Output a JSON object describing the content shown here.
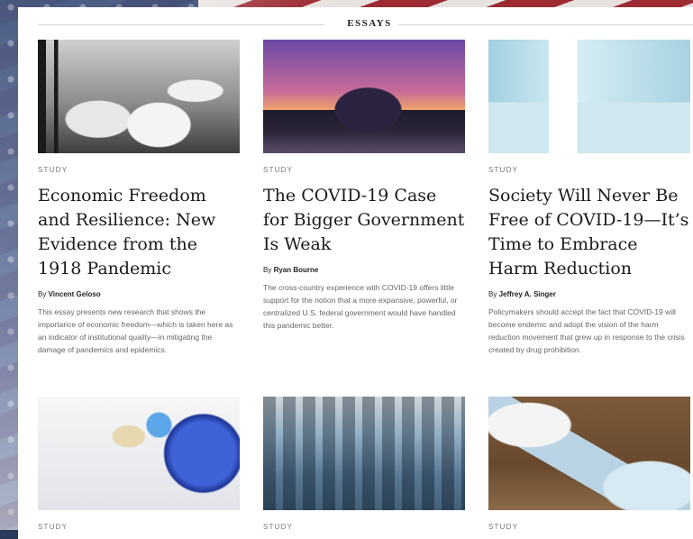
{
  "section": {
    "title": "ESSAYS"
  },
  "cards": [
    {
      "eyebrow": "STUDY",
      "title": "Economic Freedom and Resilience: New Evidence from the 1918 Pandemic",
      "by": "By",
      "author": "Vincent Geloso",
      "summary": "This essay presents new research that shows the importance of economic freedom—which is taken here as an indicator of institutional quality—in mitigating the damage of pandemics and epidemics.",
      "image": "1918-hospital-ward-photo"
    },
    {
      "eyebrow": "STUDY",
      "title": "The COVID-19 Case for Bigger Government Is Weak",
      "by": "By",
      "author": "Ryan Bourne",
      "summary": "The cross-country experience with COVID-19 offers little support for the notion that a more expansive, powerful, or centralized U.S. federal government would have handled this pandemic better.",
      "image": "us-capitol-at-sunset-photo"
    },
    {
      "eyebrow": "STUDY",
      "title": "Society Will Never Be Free of COVID-19—It’s Time to Embrace Harm Reduction",
      "by": "By",
      "author": "Jeffrey A. Singer",
      "summary": "Policymakers should accept the fact that COVID-19 will become endemic and adopt the vision of the harm reduction movement that grew up in response to the crisis created by drug prohibition.",
      "image": "covid-19-vaccine-vial-photo"
    },
    {
      "eyebrow": "STUDY",
      "image": "vaccine-vials-and-globe-photo"
    },
    {
      "eyebrow": "STUDY",
      "image": "city-skyline-and-coins-photo"
    },
    {
      "eyebrow": "STUDY",
      "image": "face-masks-and-sanitizer-photo"
    }
  ]
}
